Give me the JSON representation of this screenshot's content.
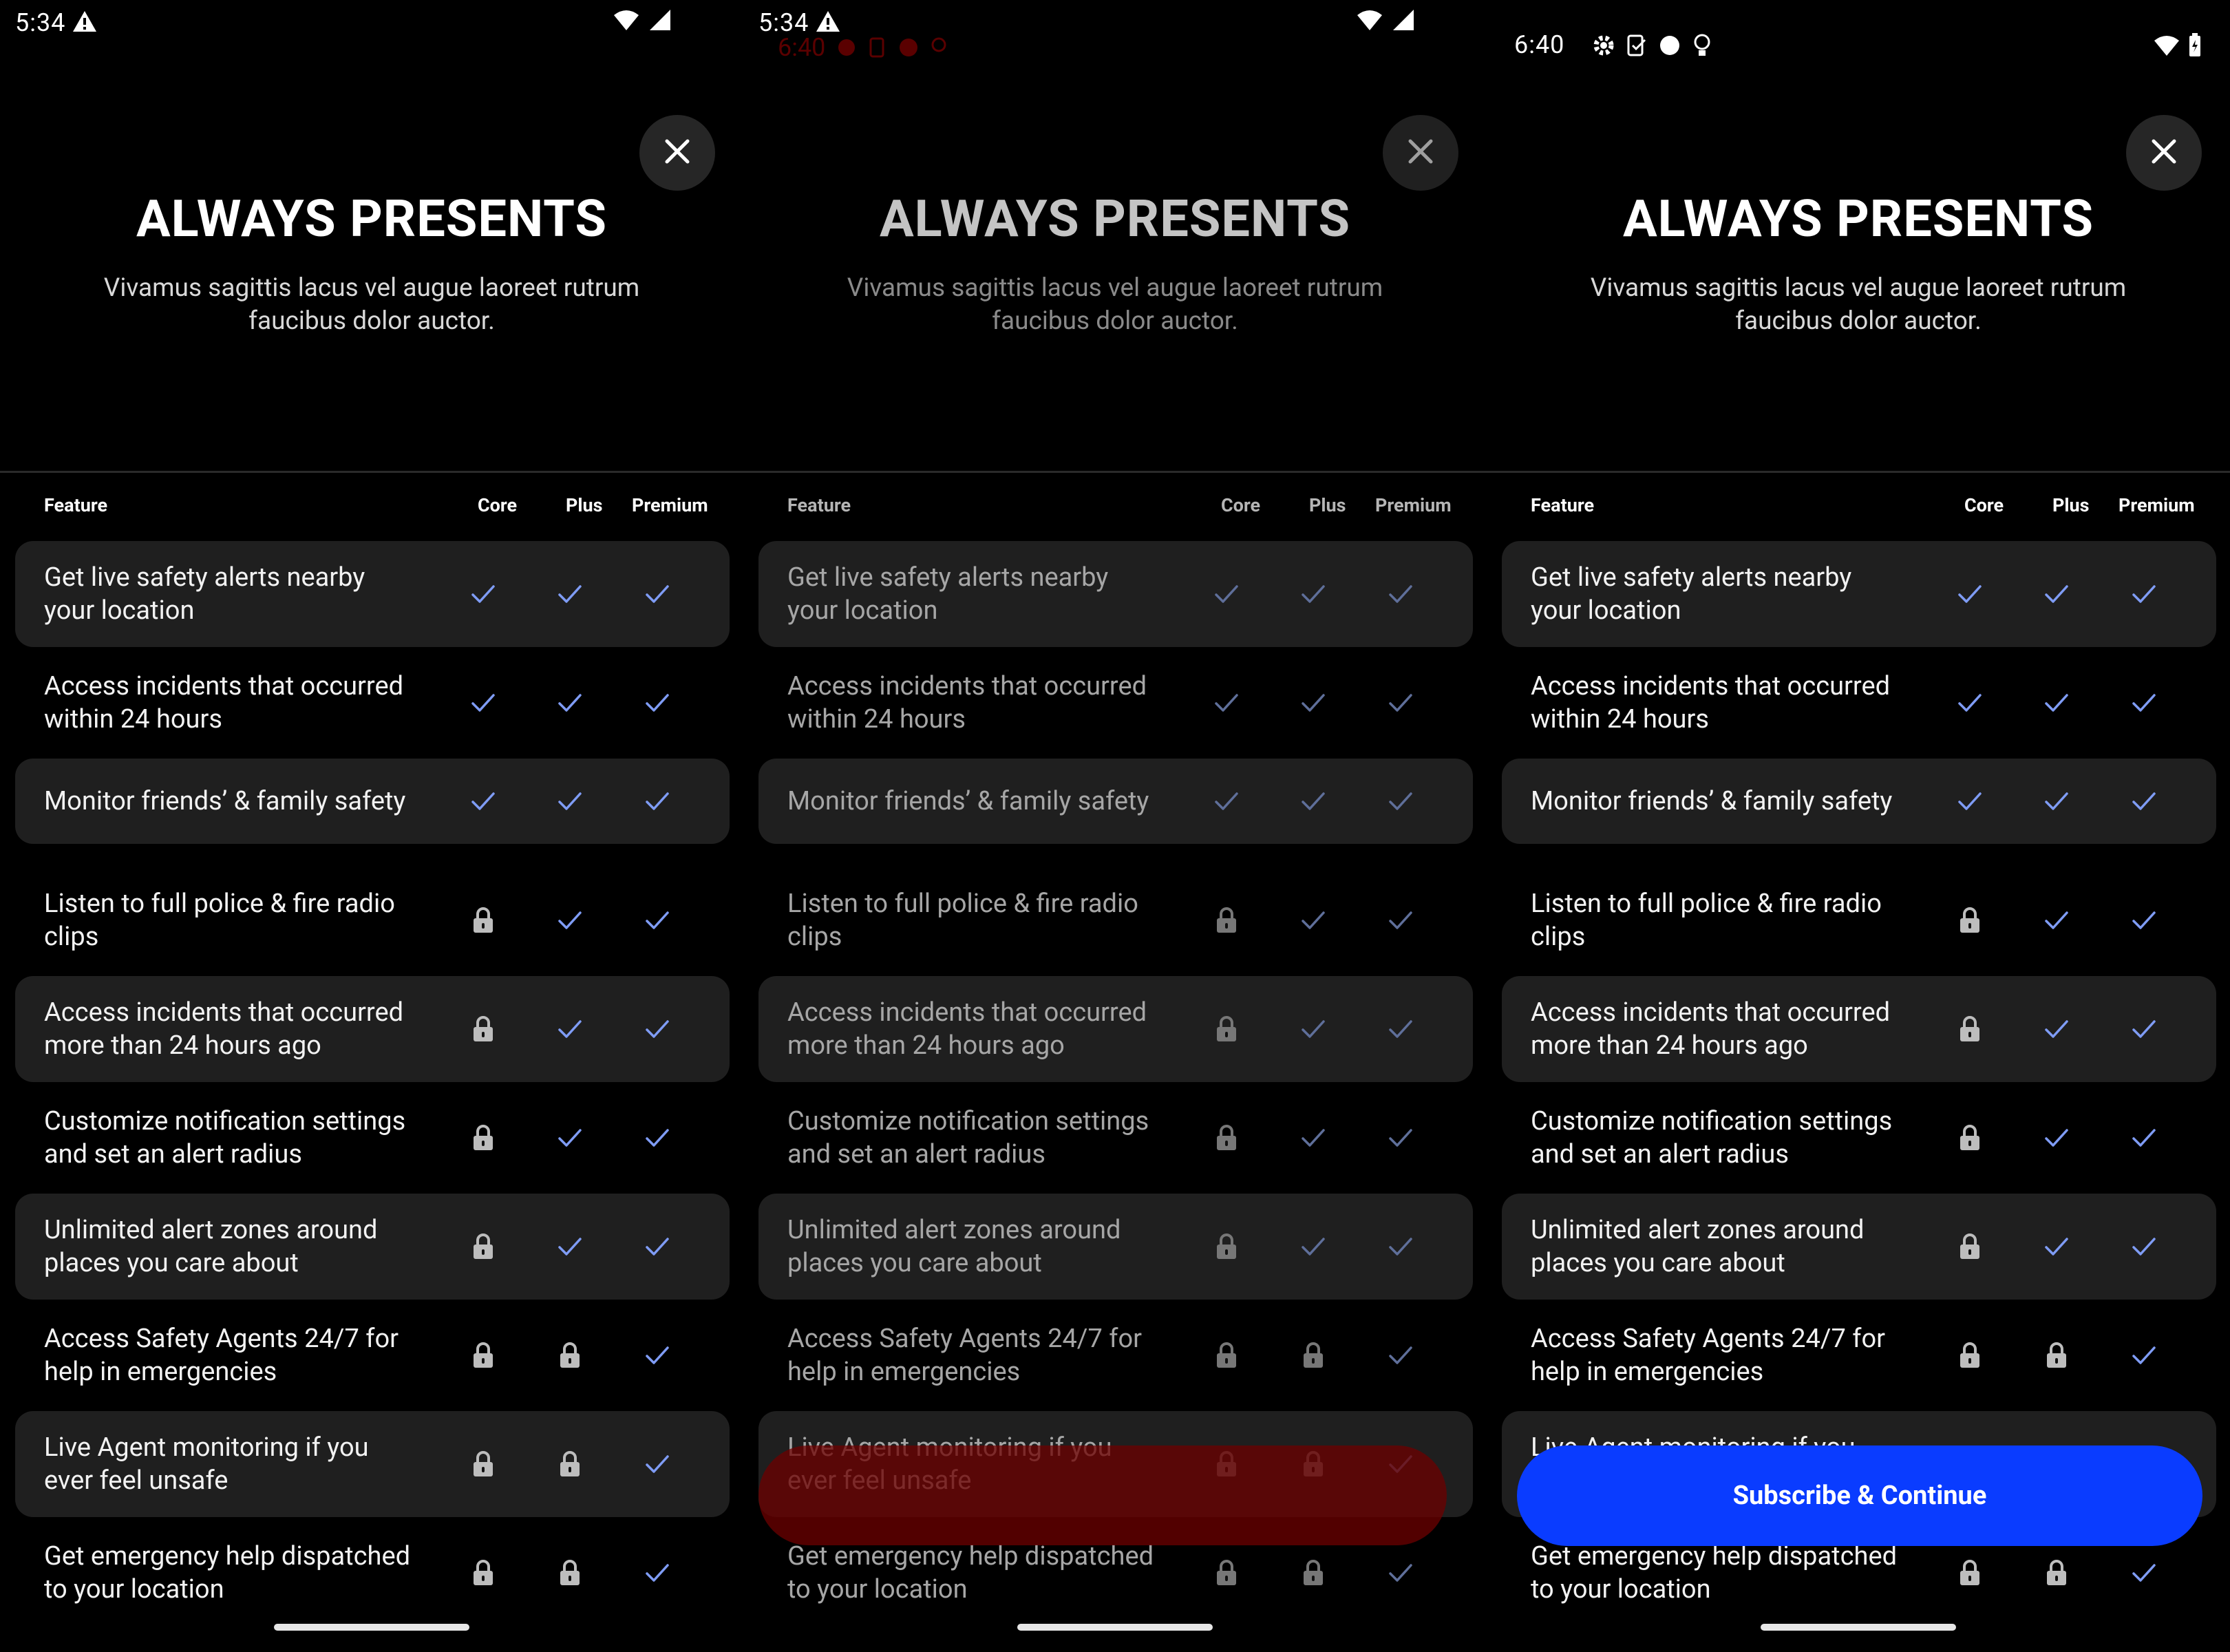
{
  "colors": {
    "accent": "#0a3cff",
    "check": "#7f9cf5",
    "lock": "#bdbdbd",
    "row_shade": "#1f1f1f"
  },
  "screens": [
    {
      "status": {
        "time": "5:34",
        "alert_icon": "warning-icon",
        "wifi": "wifi-icon",
        "signal": "signal-icon"
      }
    },
    {
      "status": {
        "time": "5:34",
        "ghost_time": "6:40",
        "alert_icon": "warning-icon"
      }
    },
    {
      "status": {
        "time": "6:40",
        "icons": [
          "gear-icon",
          "clipboard-icon",
          "dot-icon",
          "bulb-icon"
        ],
        "battery": "battery-icon"
      }
    }
  ],
  "header": {
    "title": "ALWAYS PRESENTS",
    "subtitle_line1": "Vivamus sagittis lacus vel augue laoreet rutrum",
    "subtitle_line2": "faucibus dolor auctor."
  },
  "table": {
    "headers": {
      "feature": "Feature",
      "core": "Core",
      "plus": "Plus",
      "premium": "Premium"
    },
    "rows": [
      {
        "l1": "Get live safety alerts nearby",
        "l2": "your location",
        "core": "check",
        "plus": "check",
        "premium": "check"
      },
      {
        "l1": "Access incidents that occurred",
        "l2": "within 24 hours",
        "core": "check",
        "plus": "check",
        "premium": "check"
      },
      {
        "l1": "Monitor friends’ & family safety",
        "l2": "",
        "core": "check",
        "plus": "check",
        "premium": "check"
      },
      {
        "l1": "Listen to full police & fire radio",
        "l2": "clips",
        "core": "lock",
        "plus": "check",
        "premium": "check"
      },
      {
        "l1": "Access incidents that occurred",
        "l2": "more than 24 hours ago",
        "core": "lock",
        "plus": "check",
        "premium": "check"
      },
      {
        "l1": "Customize notification settings",
        "l2": "and set an alert radius",
        "core": "lock",
        "plus": "check",
        "premium": "check"
      },
      {
        "l1": "Unlimited alert zones around",
        "l2": "places you care about",
        "core": "lock",
        "plus": "check",
        "premium": "check"
      },
      {
        "l1": "Access Safety Agents 24/7 for",
        "l2": "help in emergencies",
        "core": "lock",
        "plus": "lock",
        "premium": "check"
      },
      {
        "l1": "Live Agent monitoring if you",
        "l2": "ever feel unsafe",
        "core": "lock",
        "plus": "lock",
        "premium": "check"
      },
      {
        "l1": "Get emergency help dispatched",
        "l2": "to your location",
        "core": "lock",
        "plus": "lock",
        "premium": "check"
      }
    ]
  },
  "cta": {
    "subscribe_label": "Subscribe & Continue"
  }
}
